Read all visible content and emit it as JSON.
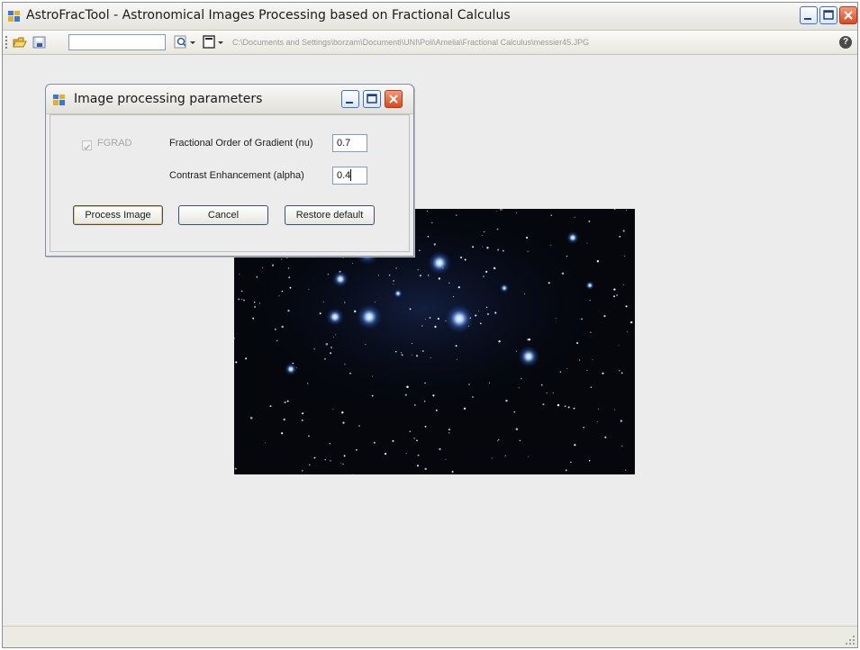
{
  "window": {
    "title": "AstroFracTool - Astronomical Images Processing based on Fractional Calculus",
    "path": "C:\\Documents and Settings\\borzam\\Documenti\\UNI\\Poli\\Amelia\\Fractional Calculus\\messier45.JPG",
    "help_label": "?"
  },
  "dialog": {
    "title": "Image processing parameters",
    "checkbox_label": "FGRAD",
    "checkbox_checked": true,
    "checkbox_enabled": false,
    "params": [
      {
        "label": "Fractional Order of Gradient (nu)",
        "value": "0.7"
      },
      {
        "label": "Contrast Enhancement (alpha)",
        "value": "0.4"
      }
    ],
    "buttons": {
      "process": "Process Image",
      "cancel": "Cancel",
      "restore": "Restore default"
    }
  },
  "colors": {
    "accent": "#3a4e7a",
    "close_button": "#d9491f",
    "sky": "#06080f",
    "star": "#9ec8ff"
  },
  "icons": [
    "app-icon",
    "open-folder-icon",
    "save-icon",
    "zoom-icon",
    "page-icon",
    "help-icon",
    "minimize-icon",
    "maximize-icon",
    "close-icon"
  ]
}
